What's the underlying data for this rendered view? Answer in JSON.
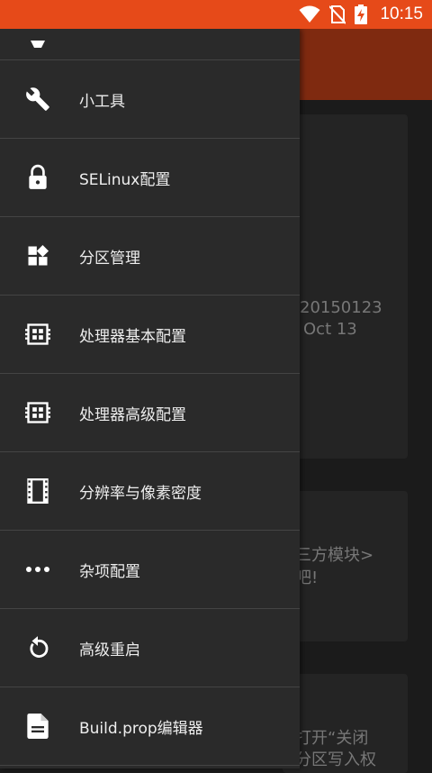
{
  "status_bar": {
    "time": "10:15",
    "icons": [
      "wifi-icon",
      "no-sim-icon",
      "battery-charging-icon"
    ],
    "color": "#e64a19"
  },
  "background": {
    "text_lines": [
      "20150123",
      "Oct 13",
      "三方模块>",
      "吧!",
      "打开“关闭",
      "分区写入权"
    ]
  },
  "drawer": {
    "items": [
      {
        "label": "",
        "icon": "partial-icon"
      },
      {
        "label": "小工具",
        "icon": "wrench-icon"
      },
      {
        "label": "SELinux配置",
        "icon": "lock-icon"
      },
      {
        "label": "分区管理",
        "icon": "widgets-icon"
      },
      {
        "label": "处理器基本配置",
        "icon": "cpu-icon"
      },
      {
        "label": "处理器高级配置",
        "icon": "cpu-icon"
      },
      {
        "label": "分辨率与像素密度",
        "icon": "film-icon"
      },
      {
        "label": "杂项配置",
        "icon": "more-dots-icon"
      },
      {
        "label": "高级重启",
        "icon": "restart-icon"
      },
      {
        "label": "Build.prop编辑器",
        "icon": "file-document-icon"
      }
    ]
  }
}
